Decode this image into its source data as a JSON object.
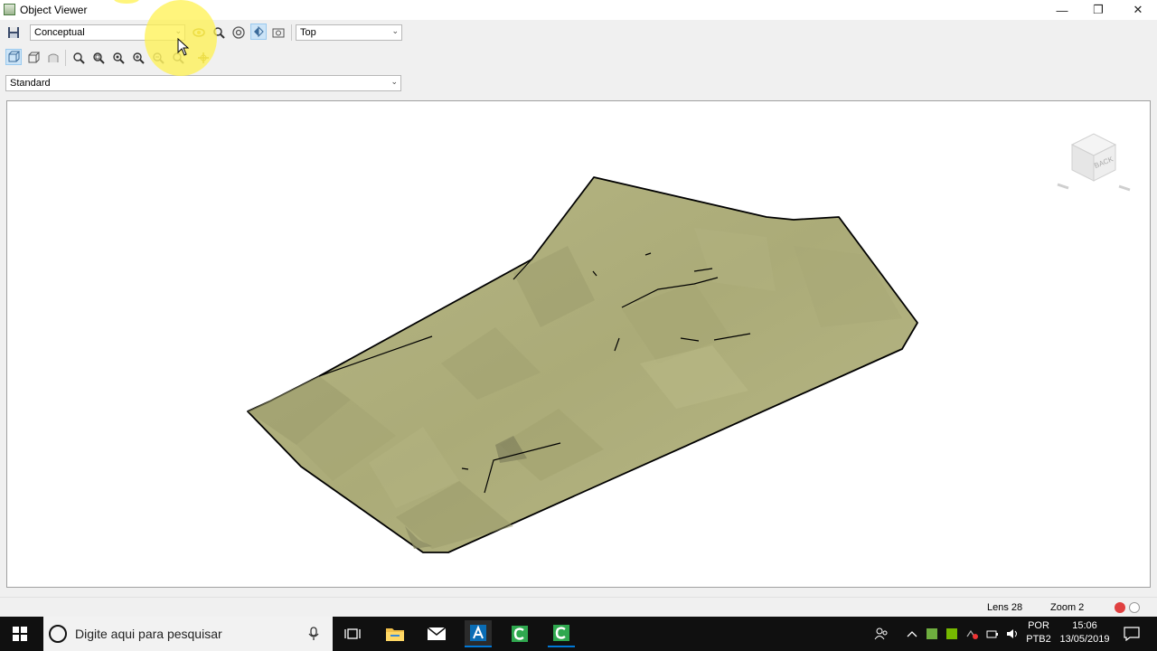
{
  "window": {
    "title": "Object Viewer",
    "minimize_glyph": "—",
    "maximize_glyph": "❐",
    "close_glyph": "✕"
  },
  "toolbar": {
    "visual_style": "Conceptual",
    "view": "Top",
    "icons_row1": [
      "save-icon",
      "orbit-icon",
      "zoom-icon",
      "steering-wheel-icon",
      "view-navigate-icon",
      "camera-icon"
    ],
    "icons_row2": [
      "box-view-icon",
      "box-iso-icon",
      "shaded-icon",
      "zoom-realtime-icon",
      "zoom-window-icon",
      "zoom-extents-icon",
      "zoom-in-icon",
      "zoom-out-icon",
      "zoom-previous-icon",
      "pan-icon"
    ]
  },
  "display_style": "Standard",
  "viewcube": {
    "face_label": "BACK"
  },
  "statusbar": {
    "lens": "Lens 28",
    "zoom": "Zoom 2"
  },
  "colors": {
    "surface": "#aeae7a",
    "accent": "#0078d7",
    "highlight": "#fff250"
  },
  "taskbar": {
    "search_placeholder": "Digite aqui para pesquisar",
    "lang_top": "POR",
    "lang_bottom": "PTB2",
    "time": "15:06",
    "date": "13/05/2019"
  }
}
